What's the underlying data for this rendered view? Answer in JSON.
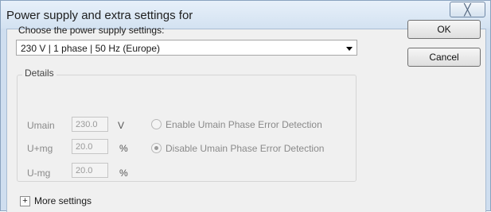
{
  "window": {
    "title": "Power supply and extra settings for",
    "close_glyph": "╳"
  },
  "supply": {
    "prompt": "Choose the power supply settings:",
    "selected": "230 V | 1 phase | 50 Hz (Europe)"
  },
  "buttons": {
    "ok": "OK",
    "cancel": "Cancel"
  },
  "details": {
    "legend": "Details",
    "rows": [
      {
        "label": "Umain",
        "value": "230.0",
        "unit": "V"
      },
      {
        "label": "U+mg",
        "value": "20.0",
        "unit": "%"
      },
      {
        "label": "U-mg",
        "value": "20.0",
        "unit": "%"
      }
    ],
    "options": [
      {
        "label": "Enable Umain Phase Error Detection",
        "checked": false
      },
      {
        "label": "Disable Umain Phase Error Detection",
        "checked": true
      }
    ]
  },
  "more": {
    "glyph": "+",
    "label": "More settings"
  }
}
